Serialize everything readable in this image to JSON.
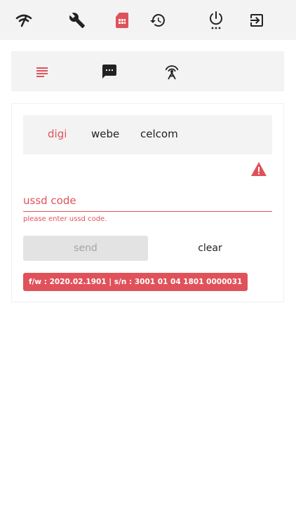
{
  "topbar": {
    "icons": [
      "wifi-icon",
      "wrench-icon",
      "sim-card-icon",
      "history-icon",
      "power-icon",
      "logout-icon"
    ],
    "active_color": "#e0525a",
    "icon_color": "#222222"
  },
  "subtabs": {
    "icons": [
      "list-icon",
      "sms-icon",
      "antenna-icon"
    ],
    "active": "list-icon"
  },
  "operators": {
    "tabs": [
      "digi",
      "webe",
      "celcom"
    ],
    "active": "digi"
  },
  "form": {
    "ussd_placeholder": "ussd code",
    "ussd_value": "",
    "error_text": "please enter ussd code.",
    "send_label": "send",
    "clear_label": "clear"
  },
  "footer": {
    "fw_label": "f/w : 2020.02.1901 | s/n : 3001 01 04 1801 0000031"
  },
  "colors": {
    "accent": "#e0525a",
    "panel_bg": "#f3f3f3",
    "button_disabled": "#e3e3e3"
  }
}
